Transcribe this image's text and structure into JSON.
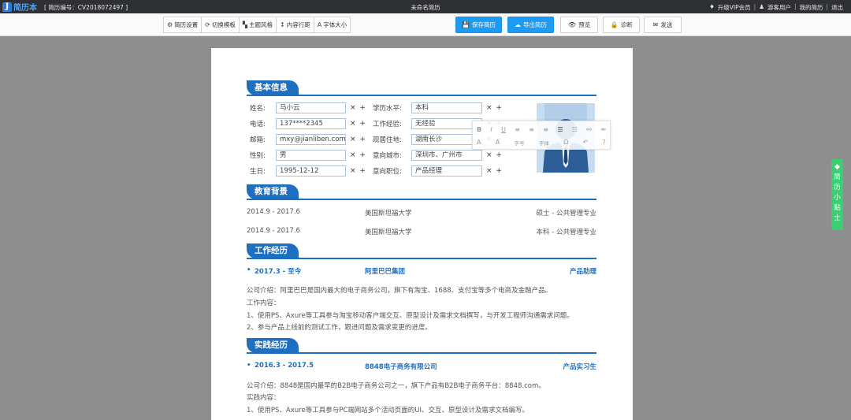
{
  "app": {
    "logo_mark": "J",
    "logo_text": "简历本",
    "resume_no": "[ 简历编号：CV2018072497 ]",
    "doc_title": "未命名简历",
    "links": [
      "升级VIP会员",
      "游客用户",
      "我的简历",
      "退出"
    ]
  },
  "toolbar": {
    "group": [
      {
        "icon": "⚙",
        "label": "简历设置"
      },
      {
        "icon": "⟳",
        "label": "切换模板"
      },
      {
        "icon": "▚",
        "label": "主题风格"
      },
      {
        "icon": "↕",
        "label": "内容行距"
      },
      {
        "icon": "A",
        "label": "字体大小"
      }
    ],
    "save": {
      "icon": "💾",
      "label": "保存简历"
    },
    "export": {
      "icon": "☁",
      "label": "导出简历"
    },
    "preview": {
      "icon": "👁",
      "label": "预览"
    },
    "diagnose": {
      "icon": "🔒",
      "label": "诊断"
    },
    "send": {
      "icon": "✉",
      "label": "发送"
    }
  },
  "resume": {
    "sections": {
      "basic": "基本信息",
      "education": "教育背景",
      "work": "工作经历",
      "practice": "实践经历"
    },
    "basic_left": [
      {
        "label": "姓名:",
        "value": "马小云"
      },
      {
        "label": "电话:",
        "value": "137****2345"
      },
      {
        "label": "邮箱:",
        "value": "mxy@jianliben.com"
      },
      {
        "label": "性别:",
        "value": "男"
      },
      {
        "label": "生日:",
        "value": "1995-12-12"
      }
    ],
    "basic_right": [
      {
        "label": "学历水平:",
        "value": "本科"
      },
      {
        "label": "工作经验:",
        "value": "无经验"
      },
      {
        "label": "现居住地:",
        "value": "湖南长沙"
      },
      {
        "label": "意向城市:",
        "value": "深圳市、广州市"
      },
      {
        "label": "意向职位:",
        "value": "产品经理"
      }
    ],
    "field_ops": "× +",
    "editor_tools_row1": [
      "B",
      "I",
      "U",
      "≡",
      "≡",
      "≡",
      "☰",
      "☷",
      "⚯",
      "⚮"
    ],
    "editor_tools_row2": [
      "A",
      "A",
      "字号",
      "字体",
      "Ω",
      "↶",
      "?"
    ],
    "education": [
      {
        "period": "2014.9 - 2017.6",
        "school": "美国斯坦福大学",
        "degree": "硕士 - 公共管理专业"
      },
      {
        "period": "2014.9 - 2017.6",
        "school": "美国斯坦福大学",
        "degree": "本科 - 公共管理专业"
      }
    ],
    "work": {
      "period": "2017.3 - 至今",
      "company": "阿里巴巴集团",
      "role": "产品助理",
      "lines": [
        "公司介绍：阿里巴巴是国内最大的电子商务公司，旗下有淘宝、1688、支付宝等多个电商及金融产品。",
        "工作内容：",
        "1、使用PS、Axure等工具参与淘宝移动客户端交互、原型设计及需求文档撰写，与开发工程师沟通需求问题。",
        "2、参与产品上线前的测试工作，跟进问题及需求变更的进度。"
      ]
    },
    "practice": {
      "period": "2016.3 - 2017.5",
      "company": "8848电子商务有限公司",
      "role": "产品实习生",
      "lines": [
        "公司介绍：8848是国内最早的B2B电子商务公司之一，旗下产品有B2B电子商务平台：8848.com。",
        "实践内容：",
        "1、使用PS、Axure等工具参与PC端网站多个活动页面的UI、交互、原型设计及需求文档编写。"
      ]
    }
  },
  "side_tab": {
    "chars": [
      "简",
      "历",
      "小",
      "贴",
      "士"
    ]
  },
  "colors": {
    "accent": "#1f6fc1",
    "primary_button": "#1e9bf0",
    "side_tab": "#3bcf73"
  }
}
